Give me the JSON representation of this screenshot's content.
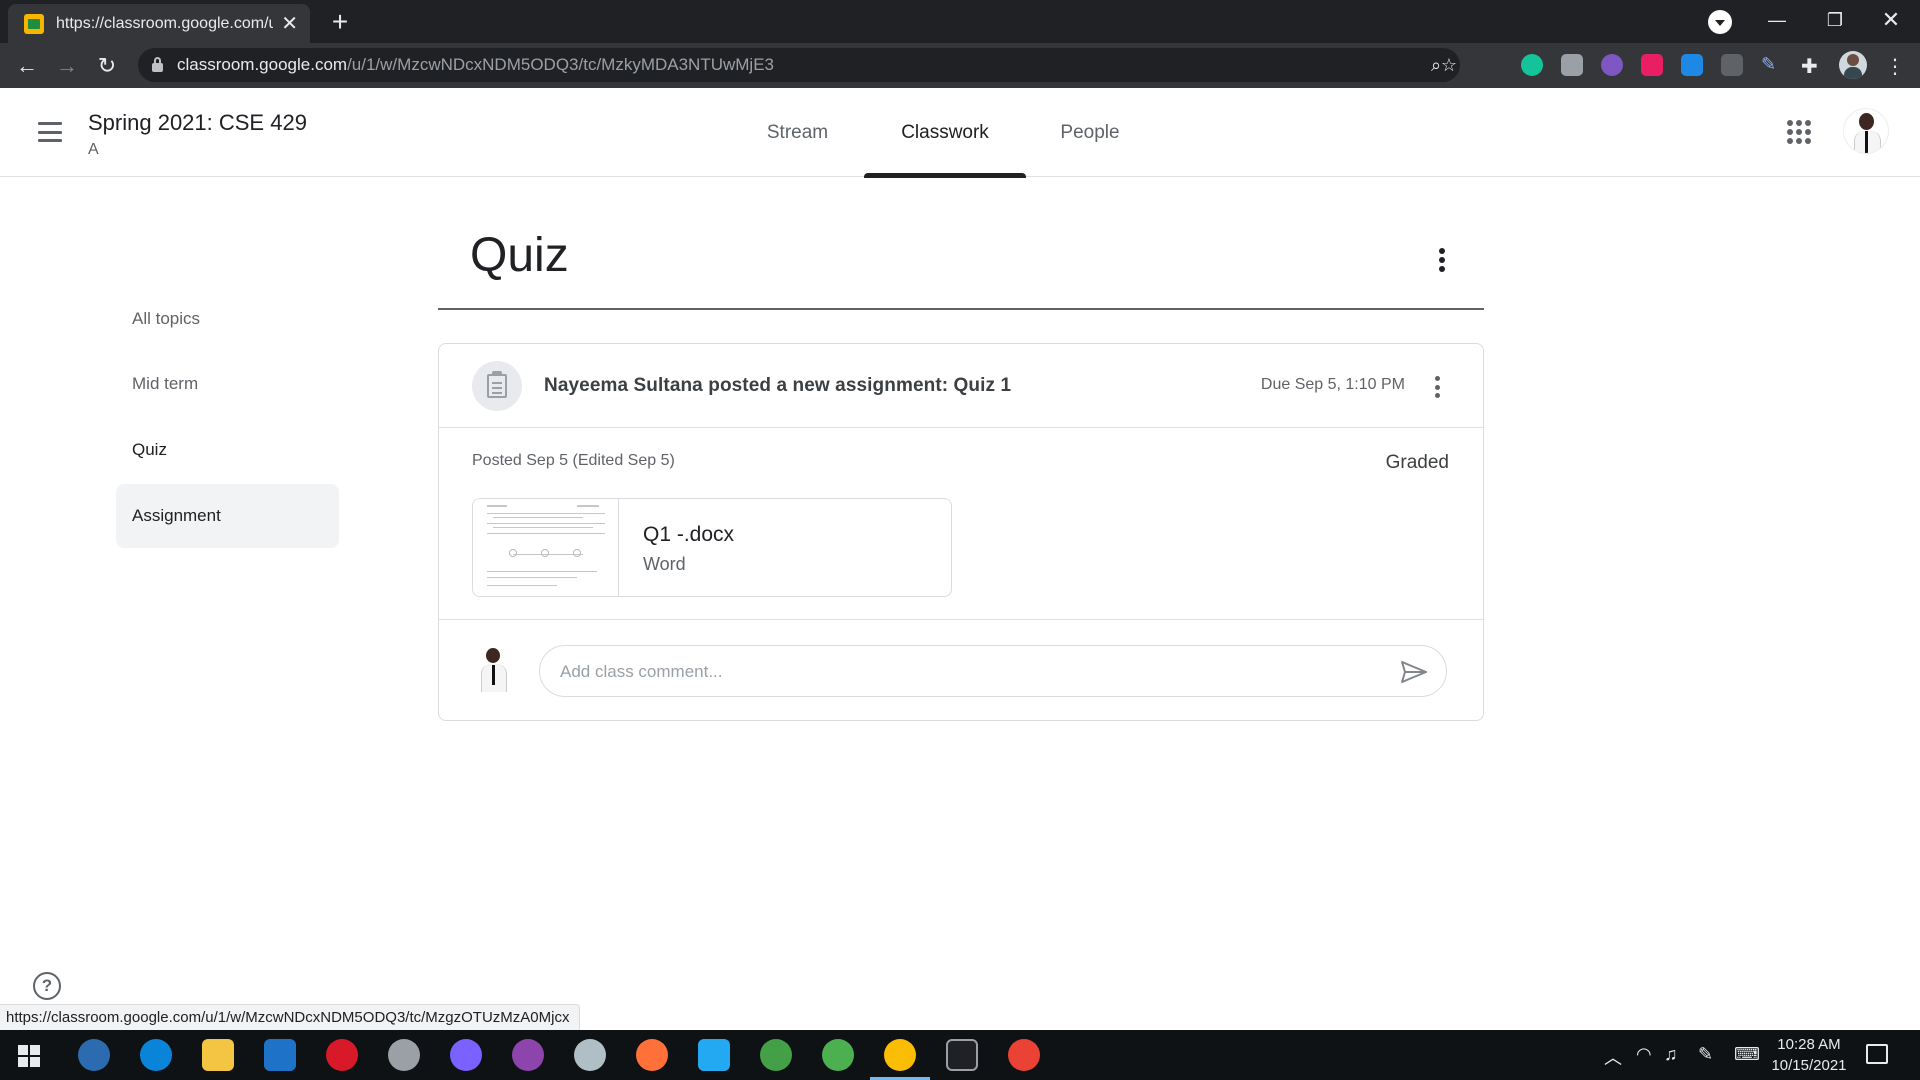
{
  "browser": {
    "tab_title": "https://classroom.google.com/u/",
    "url_host": "classroom.google.com",
    "url_path": "/u/1/w/MzcwNDcxNDM5ODQ3/tc/MzkyMDA3NTUwMjE3",
    "status_url": "https://classroom.google.com/u/1/w/MzcwNDcxNDM5ODQ3/tc/MzgzOTUzMzA0Mjcx"
  },
  "header": {
    "class_title": "Spring 2021: CSE 429",
    "class_section": "A",
    "tabs": [
      {
        "label": "Stream"
      },
      {
        "label": "Classwork"
      },
      {
        "label": "People"
      }
    ],
    "active_tab": "Classwork"
  },
  "topics": [
    {
      "label": "All topics"
    },
    {
      "label": "Mid term"
    },
    {
      "label": "Quiz"
    },
    {
      "label": "Assignment"
    }
  ],
  "main": {
    "heading": "Quiz",
    "assignment": {
      "title": "Nayeema Sultana posted a new assignment: Quiz 1",
      "due": "Due Sep 5, 1:10 PM",
      "posted": "Posted Sep 5 (Edited Sep 5)",
      "status": "Graded",
      "attachment_name": "Q1 -.docx",
      "attachment_type": "Word",
      "comment_placeholder": "Add class comment..."
    }
  },
  "taskbar": {
    "time": "10:28 AM",
    "date": "10/15/2021"
  },
  "colors": {
    "chrome_dark": "#202124",
    "toolbar": "#35363a",
    "active_underline": "#202124",
    "taskbar": "#0f1215"
  }
}
